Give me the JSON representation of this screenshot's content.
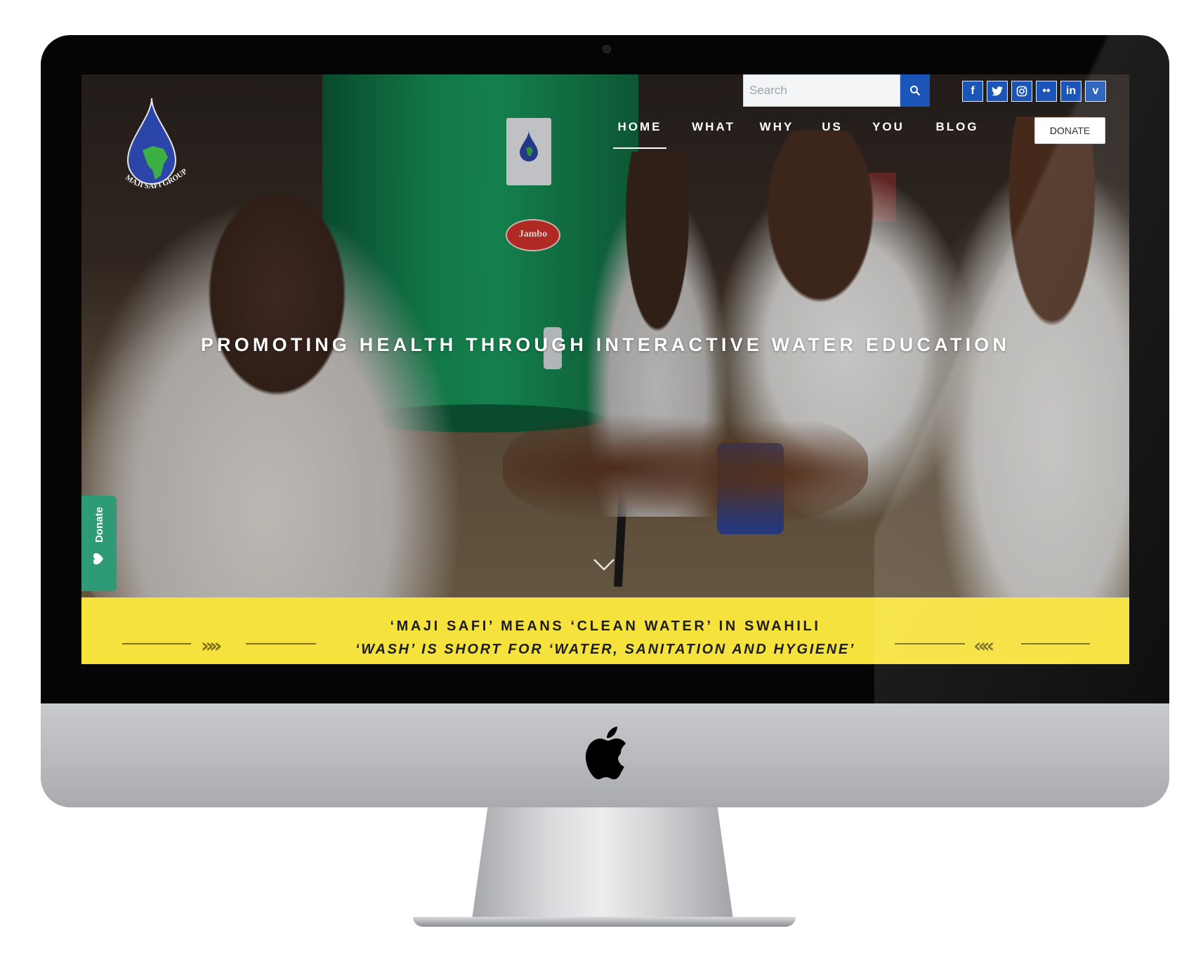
{
  "logo": {
    "text": "MAJI SAFI GROUP",
    "brand_colors": {
      "drop": "#2b45a8",
      "africa": "#3cb043",
      "ring": "#f2f2f2"
    }
  },
  "search": {
    "placeholder": "Search"
  },
  "social": {
    "items": [
      {
        "icon": "facebook-icon",
        "glyph": "f"
      },
      {
        "icon": "twitter-icon",
        "glyph": "t"
      },
      {
        "icon": "instagram-icon",
        "glyph": "◎"
      },
      {
        "icon": "flickr-icon",
        "glyph": "••"
      },
      {
        "icon": "linkedin-icon",
        "glyph": "in"
      },
      {
        "icon": "vimeo-icon",
        "glyph": "v"
      }
    ],
    "color": "#1b55b8"
  },
  "nav": {
    "items": [
      {
        "label": "HOME",
        "active": true
      },
      {
        "label": "WHAT"
      },
      {
        "label": "WHY"
      },
      {
        "label": "US"
      },
      {
        "label": "YOU"
      },
      {
        "label": "BLOG"
      }
    ],
    "donate_label": "DONATE"
  },
  "hero": {
    "title": "PROMOTING HEALTH THROUGH INTERACTIVE WATER EDUCATION",
    "photo_labels": {
      "bucket_brand": "Jambo"
    }
  },
  "donate_tab": {
    "label": "Donate",
    "color": "#2f9a76"
  },
  "banner": {
    "line1": "‘MAJI SAFI’ MEANS ‘CLEAN WATER’ IN SWAHILI",
    "line2": "‘WASH’ IS SHORT FOR ‘WATER, SANITATION AND HYGIENE’",
    "left_arrows": "»»",
    "right_arrows": "««",
    "color": "#f6e23c"
  }
}
